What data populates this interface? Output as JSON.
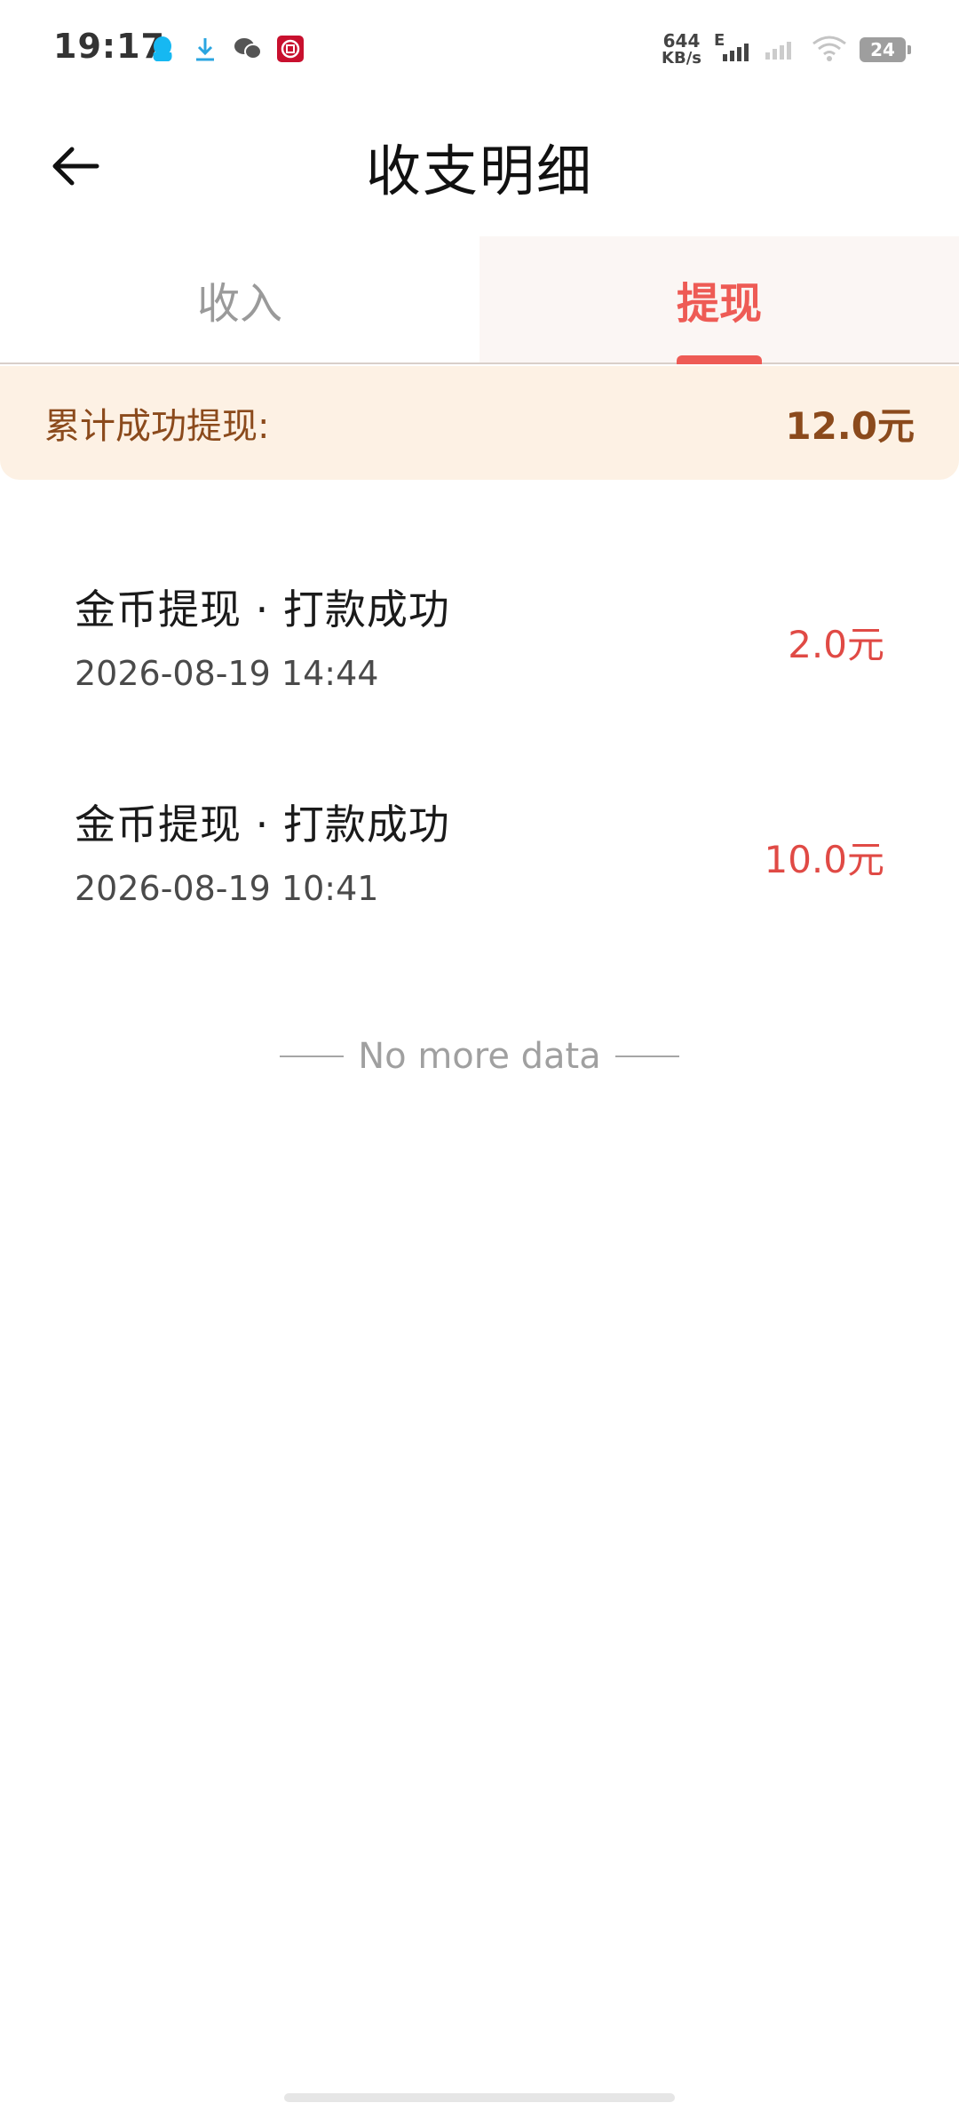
{
  "status_bar": {
    "time": "19:17",
    "net_speed_value": "644",
    "net_speed_unit": "KB/s",
    "network_type": "E",
    "battery": "24",
    "icons": [
      "qq-icon",
      "download-icon",
      "wechat-icon",
      "app-red-icon",
      "signal-icon",
      "signal-2-icon",
      "wifi-icon",
      "battery-icon"
    ]
  },
  "header": {
    "title": "收支明细"
  },
  "tabs": [
    {
      "label": "收入",
      "active": false
    },
    {
      "label": "提现",
      "active": true
    }
  ],
  "summary": {
    "label": "累计成功提现:",
    "amount": "12.0元"
  },
  "records": [
    {
      "title": "金币提现 · 打款成功",
      "time": "2026-08-19 14:44",
      "amount": "2.0元"
    },
    {
      "title": "金币提现 · 打款成功",
      "time": "2026-08-19 10:41",
      "amount": "10.0元"
    }
  ],
  "footer": {
    "no_more_text": "No more data"
  },
  "colors": {
    "accent": "#ee5b55",
    "amount_red": "#e04a45",
    "summary_bg": "#fdf1e4",
    "summary_text": "#8b4a1c"
  }
}
